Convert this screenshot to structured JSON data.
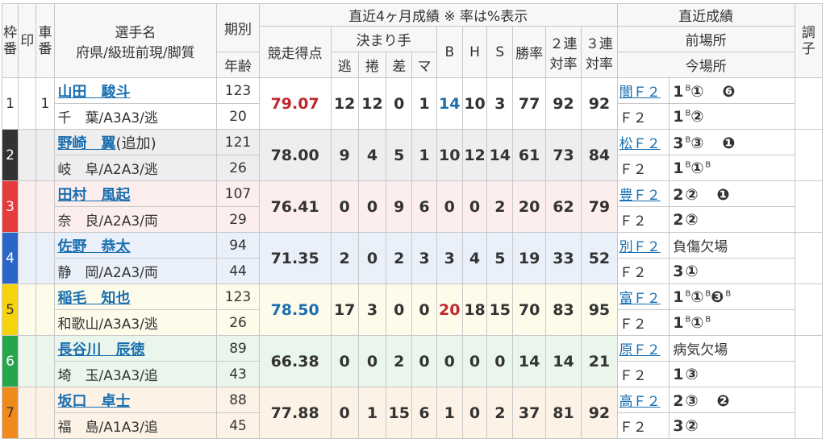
{
  "headers": {
    "waku": "枠番",
    "mark": "印",
    "car": "車番",
    "name_line1": "選手名",
    "name_line2": "府県/級班前現/脚質",
    "term": "期別",
    "age": "年齢",
    "recent4": "直近4ヶ月成績 ※ 率は%表示",
    "score": "競走得点",
    "kimarite": "決まり手",
    "nige": "逃",
    "makuri": "捲",
    "sashi": "差",
    "mark_win": "マ",
    "b": "B",
    "h": "H",
    "s": "S",
    "win_rate": "勝率",
    "rentai2_a": "２連",
    "rentai2_b": "対率",
    "rentai3_a": "３連",
    "rentai3_b": "対率",
    "recent_results": "直近成績",
    "prev_venue": "前場所",
    "this_venue": "今場所",
    "condition": "調子"
  },
  "racers": [
    {
      "frame": "",
      "car": "1",
      "name": "山田　駿斗",
      "extra": "",
      "pref": "千　葉/A3A3/逃",
      "term": "123",
      "age": "20",
      "score": "79.07",
      "score_color": "red",
      "nige": "12",
      "makuri": "12",
      "sashi": "0",
      "mark": "1",
      "b": "14",
      "b_color": "blue",
      "h": "10",
      "s": "3",
      "win": "77",
      "r2": "92",
      "r3": "92",
      "prev_venue": "闇Ｆ２",
      "prev_result": "1",
      "prev_sup": "B",
      "prev_rest": "①　❻",
      "prev_sup2": "",
      "this_venue": "Ｆ２",
      "this_result": "1",
      "this_sup": "B",
      "this_rest": "②",
      "this_sup2": ""
    },
    {
      "frame": "2",
      "car": "",
      "name": "野崎　翼",
      "extra": "(追加)",
      "pref": "岐　阜/A2A3/逃",
      "term": "121",
      "age": "26",
      "score": "78.00",
      "score_color": "",
      "nige": "9",
      "makuri": "4",
      "sashi": "5",
      "mark": "1",
      "b": "10",
      "b_color": "",
      "h": "12",
      "s": "14",
      "win": "61",
      "r2": "73",
      "r3": "84",
      "prev_venue": "松Ｆ２",
      "prev_result": "3",
      "prev_sup": "B",
      "prev_rest": "③　❶",
      "prev_sup2": "",
      "this_venue": "Ｆ２",
      "this_result": "1",
      "this_sup": "B",
      "this_rest": "①",
      "this_sup2": "B"
    },
    {
      "frame": "3",
      "car": "",
      "name": "田村　風起",
      "extra": "",
      "pref": "奈　良/A2A3/両",
      "term": "107",
      "age": "29",
      "score": "76.41",
      "score_color": "",
      "nige": "0",
      "makuri": "0",
      "sashi": "9",
      "mark": "6",
      "b": "0",
      "b_color": "",
      "h": "0",
      "s": "2",
      "win": "20",
      "r2": "62",
      "r3": "79",
      "prev_venue": "豊Ｆ２",
      "prev_result": "2",
      "prev_sup": "",
      "prev_rest": "②　❶",
      "prev_sup2": "",
      "this_venue": "Ｆ２",
      "this_result": "2",
      "this_sup": "",
      "this_rest": "②",
      "this_sup2": ""
    },
    {
      "frame": "4",
      "car": "",
      "name": "佐野　恭太",
      "extra": "",
      "pref": "静　岡/A2A3/両",
      "term": "94",
      "age": "44",
      "score": "71.35",
      "score_color": "",
      "nige": "2",
      "makuri": "0",
      "sashi": "2",
      "mark": "3",
      "b": "3",
      "b_color": "",
      "h": "4",
      "s": "5",
      "win": "19",
      "r2": "33",
      "r3": "52",
      "prev_venue": "別Ｆ２",
      "prev_result": "負傷欠場",
      "prev_sup": "",
      "prev_rest": "",
      "prev_sup2": "",
      "this_venue": "Ｆ２",
      "this_result": "3",
      "this_sup": "",
      "this_rest": "①",
      "this_sup2": ""
    },
    {
      "frame": "5",
      "car": "",
      "name": "稲毛　知也",
      "extra": "",
      "pref": "和歌山/A3A3/逃",
      "term": "123",
      "age": "26",
      "score": "78.50",
      "score_color": "blue",
      "nige": "17",
      "makuri": "3",
      "sashi": "0",
      "mark": "0",
      "b": "20",
      "b_color": "red",
      "h": "18",
      "s": "15",
      "win": "70",
      "r2": "83",
      "r3": "95",
      "prev_venue": "富Ｆ２",
      "prev_result": "1",
      "prev_sup": "B",
      "prev_rest": "①",
      "prev_sup2": "B",
      "prev_rest2": "❸",
      "prev_sup3": "B",
      "this_venue": "Ｆ２",
      "this_result": "1",
      "this_sup": "B",
      "this_rest": "①",
      "this_sup2": "B"
    },
    {
      "frame": "6",
      "car": "",
      "name": "長谷川　辰徳",
      "extra": "",
      "pref": "埼　玉/A3A3/追",
      "term": "89",
      "age": "43",
      "score": "66.38",
      "score_color": "",
      "nige": "0",
      "makuri": "0",
      "sashi": "2",
      "mark": "0",
      "b": "0",
      "b_color": "",
      "h": "0",
      "s": "0",
      "win": "14",
      "r2": "14",
      "r3": "21",
      "prev_venue": "原Ｆ２",
      "prev_result": "病気欠場",
      "prev_sup": "",
      "prev_rest": "",
      "prev_sup2": "",
      "this_venue": "Ｆ２",
      "this_result": "1",
      "this_sup": "",
      "this_rest": "③",
      "this_sup2": ""
    },
    {
      "frame": "7",
      "car": "",
      "name": "坂口　卓士",
      "extra": "",
      "pref": "福　島/A1A3/追",
      "term": "88",
      "age": "45",
      "score": "77.88",
      "score_color": "",
      "nige": "0",
      "makuri": "1",
      "sashi": "15",
      "mark": "6",
      "b": "1",
      "b_color": "",
      "h": "0",
      "s": "2",
      "win": "37",
      "r2": "81",
      "r3": "92",
      "prev_venue": "高Ｆ２",
      "prev_result": "2",
      "prev_sup": "",
      "prev_rest": "③　❷",
      "prev_sup2": "",
      "this_venue": "Ｆ２",
      "this_result": "3",
      "this_sup": "",
      "this_rest": "②",
      "this_sup2": ""
    }
  ]
}
